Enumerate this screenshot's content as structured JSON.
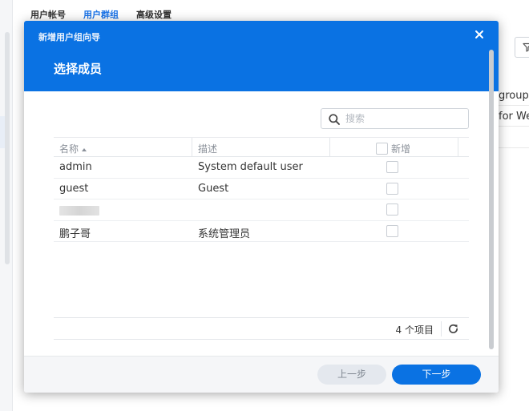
{
  "background": {
    "tabs": [
      {
        "label": "用户帐号",
        "active": false
      },
      {
        "label": "用户群组",
        "active": true
      },
      {
        "label": "高级设置",
        "active": false
      }
    ],
    "rows": [
      "group",
      "for We"
    ],
    "filter_icon": "filter-icon"
  },
  "dialog": {
    "window_title": "新增用户组向导",
    "step_title": "选择成员",
    "close_icon": "close-icon",
    "search": {
      "placeholder": "搜索",
      "value": "",
      "icon": "search-icon"
    },
    "columns": {
      "name": "名称",
      "description": "描述",
      "add": "新增"
    },
    "sort": {
      "column": "name",
      "direction": "ascending"
    },
    "rows": [
      {
        "name": "admin",
        "description": "System default user",
        "checked": false,
        "name_obscured": false
      },
      {
        "name": "guest",
        "description": "Guest",
        "checked": false,
        "name_obscured": false
      },
      {
        "name": "",
        "description": "",
        "checked": false,
        "name_obscured": true
      },
      {
        "name": "鹏子哥",
        "description": "系统管理员",
        "checked": false,
        "name_obscured": false
      }
    ],
    "footer": {
      "count_label": "4 个项目",
      "refresh_icon": "refresh-icon"
    },
    "buttons": {
      "prev": "上一步",
      "next": "下一步"
    }
  },
  "colors": {
    "accent": "#0a72e3",
    "active_tab": "#1a73e8",
    "secondary_button": "#e4e8ee"
  }
}
